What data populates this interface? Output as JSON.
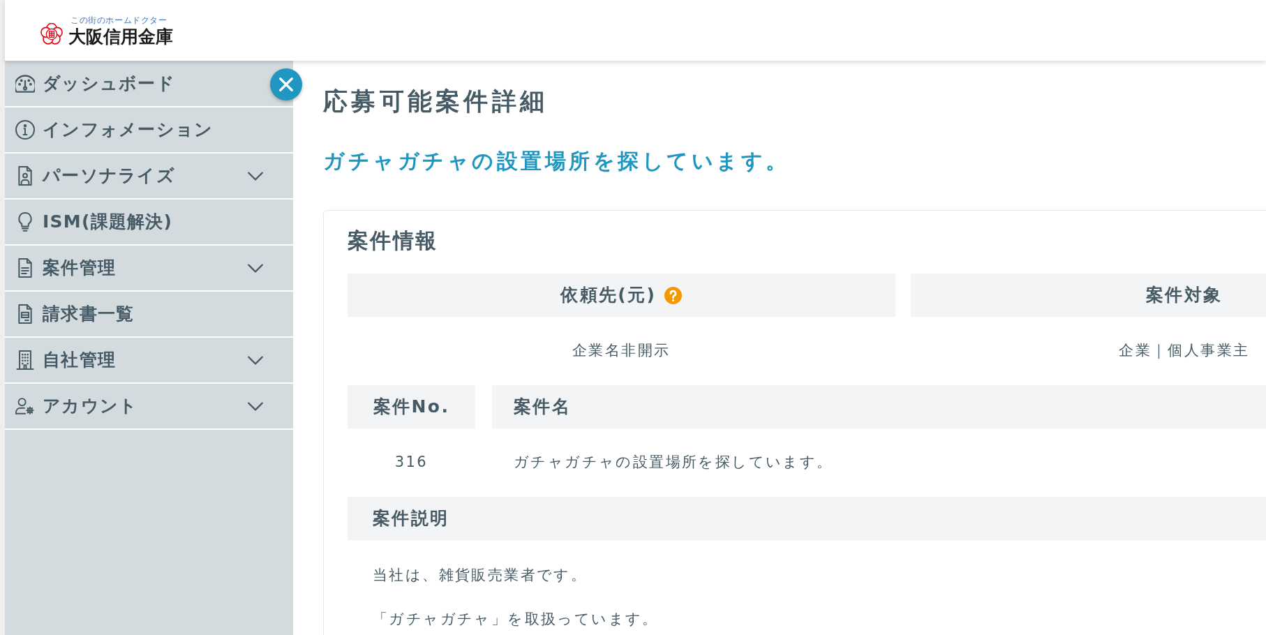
{
  "header": {
    "logo": {
      "tagline": "この街のホームドクター",
      "name": "大阪信用金庫"
    }
  },
  "sidebar": {
    "items": [
      {
        "label": "ダッシュボード",
        "has_submenu": false
      },
      {
        "label": "インフォメーション",
        "has_submenu": false
      },
      {
        "label": "パーソナライズ",
        "has_submenu": true
      },
      {
        "label": "ISM(課題解決)",
        "has_submenu": false
      },
      {
        "label": "案件管理",
        "has_submenu": true
      },
      {
        "label": "請求書一覧",
        "has_submenu": false
      },
      {
        "label": "自社管理",
        "has_submenu": true
      },
      {
        "label": "アカウント",
        "has_submenu": true
      }
    ]
  },
  "page": {
    "title": "応募可能案件詳細",
    "subtitle": "ガチャガチャの設置場所を探しています。"
  },
  "card": {
    "title": "案件情報",
    "table_1": {
      "columns": [
        {
          "heading": "依頼先(元)",
          "help_icon": true
        },
        {
          "heading": "案件対象",
          "help_icon": false
        }
      ],
      "values": [
        "企業名非開示",
        "企業｜個人事業主"
      ]
    },
    "table_2": {
      "columns": [
        {
          "heading": "案件No.",
          "help_icon": false
        },
        {
          "heading": "案件名",
          "help_icon": false
        }
      ],
      "values": [
        "316",
        "ガチャガチャの設置場所を探しています。"
      ]
    },
    "description": {
      "heading": "案件説明",
      "paragraphs": [
        "当社は、雑貨販売業者です。",
        "「ガチャガチャ」を取扱っています。"
      ]
    }
  }
}
